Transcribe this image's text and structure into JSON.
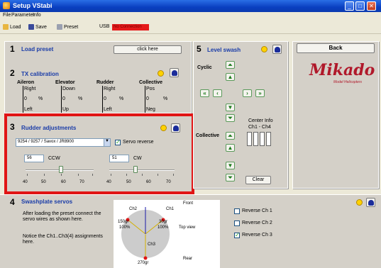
{
  "window": {
    "title": "Setup VStabi"
  },
  "menu": [
    "File",
    "Parameter",
    "Info"
  ],
  "toolbar": {
    "load": "Load",
    "save": "Save",
    "preset": "Preset",
    "usb": "USB",
    "connection": "No Connection"
  },
  "load_preset": {
    "number": "1",
    "title": "Load preset",
    "button": "click here"
  },
  "tx_calibration": {
    "number": "2",
    "title": "TX calibration",
    "columns": [
      {
        "header": "Aileron",
        "top": "Right",
        "zero": "0",
        "pct": "%",
        "bottom": "Left"
      },
      {
        "header": "Elevator",
        "top": "Down",
        "zero": "0",
        "pct": "%",
        "bottom": "Up"
      },
      {
        "header": "Rudder",
        "top": "Right",
        "zero": "0",
        "pct": "%",
        "bottom": "Left"
      },
      {
        "header": "Collective",
        "top": "Pos",
        "zero": "0",
        "pct": "%",
        "bottom": "Neg"
      }
    ]
  },
  "rudder": {
    "number": "3",
    "title": "Rudder adjustments",
    "servo_select": "9254 / 9257 / Savox / JR8900",
    "servo_reverse": "Servo reverse",
    "servo_reverse_checked": true,
    "ccw_value": "56",
    "ccw_label": "CCW",
    "cw_value": "51",
    "cw_label": "CW",
    "ccw_level": 56,
    "cw_level": 51,
    "scale": [
      "40",
      "50",
      "60",
      "70"
    ]
  },
  "level_swash": {
    "number": "5",
    "title": "Level swash",
    "cyclic": "Cyclic",
    "collective": "Collective",
    "center_info": "Center Info",
    "ch_range": "Ch1 - Ch4",
    "clear": "Clear"
  },
  "back_button": "Back",
  "logo": {
    "name": "Mikado",
    "sub": "Model Helicopters"
  },
  "swashplate": {
    "number": "4",
    "title": "Swashplate servos",
    "instructions": "After loading the preset connect the servo wires as shown here.",
    "note": "Notice the Ch1..Ch3(4) assignments here.",
    "diagram": {
      "front": "Front",
      "rear": "Rear",
      "top_view": "Top view",
      "ch1": "Ch1",
      "ch2": "Ch2",
      "ch3": "Ch3",
      "a150": "150gr",
      "a100l": "100%",
      "a30": "30gr",
      "a100r": "100%",
      "a270": "270gr"
    },
    "reverse": [
      "Reverse Ch 1",
      "Reverse Ch 2",
      "Reverse Ch 3"
    ],
    "reverse_checked": [
      false,
      false,
      true
    ]
  },
  "colors": {
    "accent_blue": "#1a3ca8",
    "red_box": "#e01515",
    "connection_red": "#e51a1a"
  }
}
